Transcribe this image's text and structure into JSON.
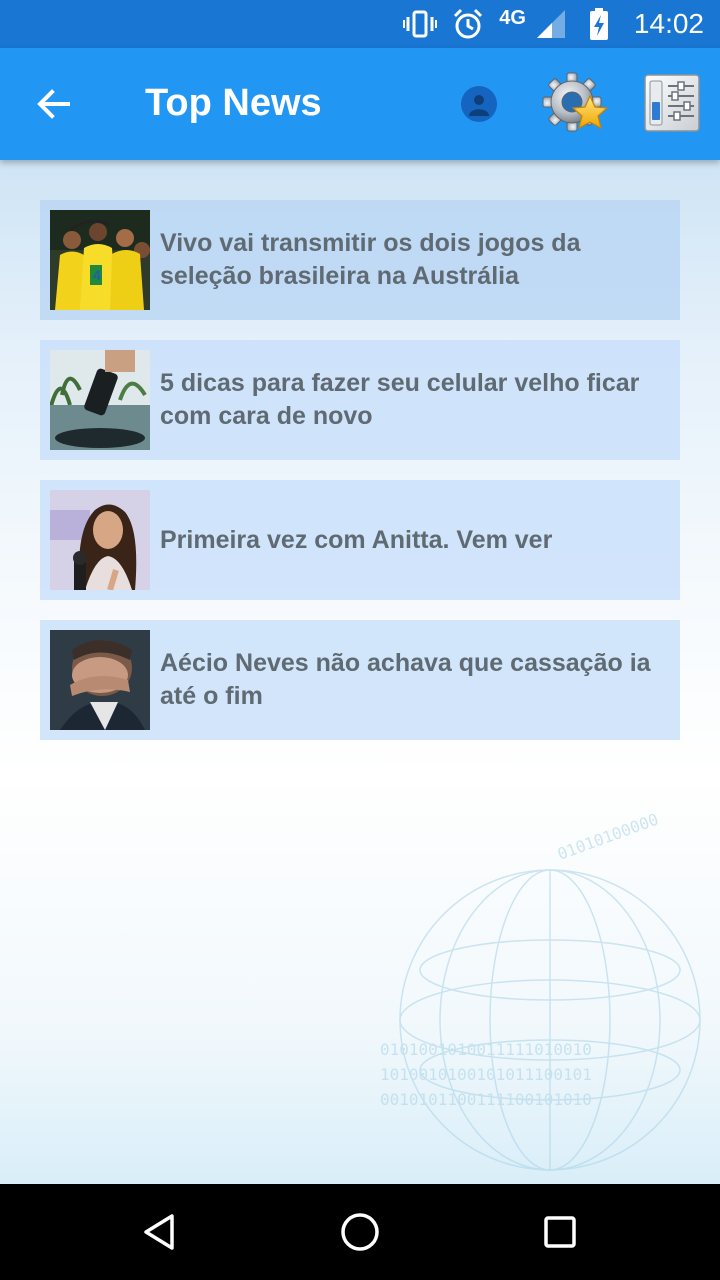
{
  "status_bar": {
    "network": "4G",
    "time": "14:02",
    "icons": [
      "vibrate-icon",
      "alarm-icon",
      "signal-icon",
      "battery-charging-icon"
    ]
  },
  "app_bar": {
    "title": "Top News",
    "icons": [
      "back-arrow-icon",
      "person-icon",
      "gear-star-icon",
      "settings-sliders-icon"
    ]
  },
  "news": [
    {
      "title": "Vivo vai transmitir os dois jogos da seleção brasileira na Austrália",
      "thumbnail": "soccer-players-thumbnail"
    },
    {
      "title": "5 dicas para fazer seu celular velho ficar com cara de novo",
      "thumbnail": "phone-over-water-thumbnail"
    },
    {
      "title": "Primeira vez com Anitta. Vem ver",
      "thumbnail": "woman-microphone-thumbnail"
    },
    {
      "title": "Aécio Neves não achava que cassação ia até o fim",
      "thumbnail": "man-hand-on-face-thumbnail"
    }
  ],
  "nav_bar": {
    "icons": [
      "back-triangle-icon",
      "home-circle-icon",
      "recents-square-icon"
    ]
  },
  "colors": {
    "status_bar": "#1976d2",
    "app_bar": "#2196f3",
    "item_background": "#cae1fa",
    "item_text": "#5f6a72"
  }
}
